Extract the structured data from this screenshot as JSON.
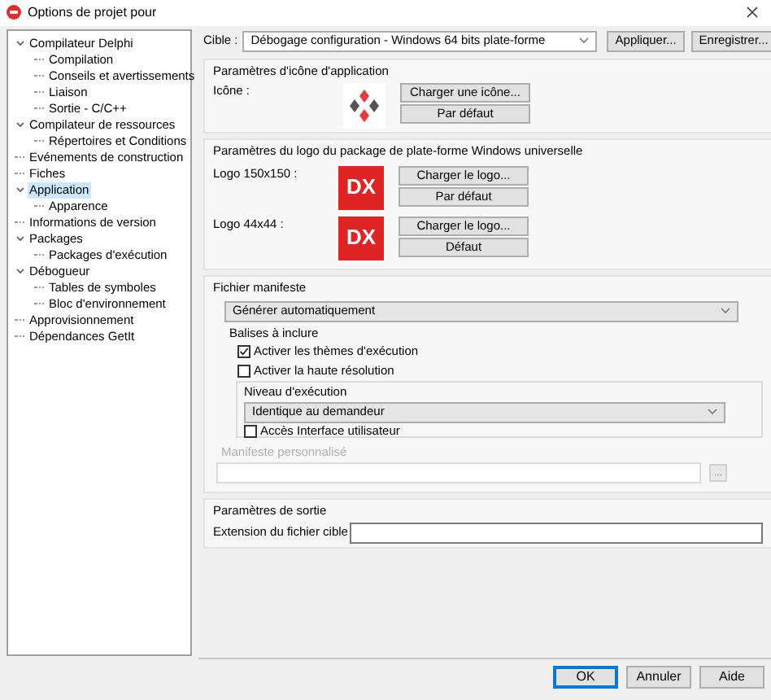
{
  "window": {
    "title": "Options de projet pour"
  },
  "tree": [
    {
      "label": "Compilateur Delphi",
      "expanded": true,
      "selected": false,
      "children": [
        {
          "label": "Compilation",
          "selected": false
        },
        {
          "label": "Conseils et avertissements",
          "selected": false
        },
        {
          "label": "Liaison",
          "selected": false
        },
        {
          "label": "Sortie - C/C++",
          "selected": false
        }
      ]
    },
    {
      "label": "Compilateur de ressources",
      "expanded": true,
      "selected": false,
      "children": [
        {
          "label": "Répertoires et Conditions",
          "selected": false
        }
      ]
    },
    {
      "label": "Evénements de construction",
      "selected": false
    },
    {
      "label": "Fiches",
      "selected": false
    },
    {
      "label": "Application",
      "expanded": true,
      "selected": true,
      "children": [
        {
          "label": "Apparence",
          "selected": false
        }
      ]
    },
    {
      "label": "Informations de version",
      "selected": false
    },
    {
      "label": "Packages",
      "expanded": true,
      "selected": false,
      "children": [
        {
          "label": "Packages d'exécution",
          "selected": false
        }
      ]
    },
    {
      "label": "Débogueur",
      "expanded": true,
      "selected": false,
      "children": [
        {
          "label": "Tables de symboles",
          "selected": false
        },
        {
          "label": "Bloc d'environnement",
          "selected": false
        }
      ]
    },
    {
      "label": "Approvisionnement",
      "selected": false
    },
    {
      "label": "Dépendances GetIt",
      "selected": false
    }
  ],
  "target": {
    "label": "Cible :",
    "value": "Débogage configuration - Windows 64 bits plate-forme",
    "buttons": [
      "Appliquer...",
      "Enregistrer..."
    ]
  },
  "icon_group": {
    "title": "Paramètres d'icône d'application",
    "label": "Icône :",
    "buttons": [
      "Charger une icône...",
      "Par défaut"
    ]
  },
  "logo_group": {
    "title": "Paramètres du logo du package de plate-forme Windows universelle",
    "logos": [
      {
        "label": "Logo 150x150 :",
        "logo_text": "DX",
        "buttons": [
          "Charger le logo...",
          "Par défaut"
        ]
      },
      {
        "label": "Logo 44x44 :",
        "logo_text": "DX",
        "buttons": [
          "Charger le logo...",
          "Défaut"
        ]
      }
    ]
  },
  "manifest": {
    "title": "Fichier manifeste",
    "mode": "Générer automatiquement",
    "tags_title": "Balises à inclure",
    "checkboxes": [
      {
        "label": "Activer les thèmes d'exécution",
        "checked": true
      },
      {
        "label": "Activer la haute résolution",
        "checked": false
      }
    ],
    "execution_level": {
      "title": "Niveau d'exécution",
      "value": "Identique au demandeur",
      "checkbox": {
        "label": "Accès Interface utilisateur",
        "checked": false
      }
    },
    "custom": {
      "label": "Manifeste personnalisé",
      "disabled": true,
      "browse": "..."
    }
  },
  "output": {
    "title": "Paramètres de sortie",
    "label": "Extension du fichier cible"
  },
  "footer": {
    "buttons": [
      {
        "label": "OK",
        "default": true
      },
      {
        "label": "Annuler",
        "default": false
      },
      {
        "label": "Aide",
        "default": false
      }
    ]
  }
}
